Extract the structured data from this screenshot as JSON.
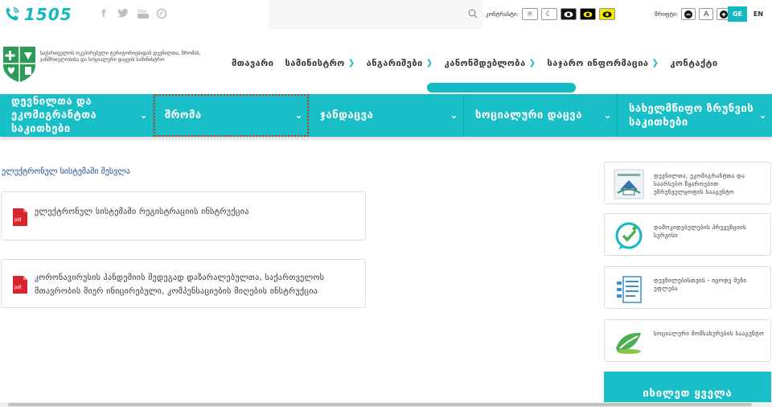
{
  "topbar": {
    "hotline": "1505",
    "social_icons": [
      "facebook-icon",
      "twitter-icon",
      "youtube-icon",
      "circle-logo-icon"
    ],
    "contrast_label": "კონტრასტი:",
    "font_label": "შრიფტი:",
    "font_buttons": [
      "−",
      "A",
      "+"
    ],
    "languages": [
      "GE",
      "EN"
    ]
  },
  "header": {
    "logo_text": "საქართველოს ოკუპირებული ტერიტორიებიდან დევნილთა, შრომის, ჯანმრთელობისა და სოციალური დაცვის სამინისტრო",
    "nav": [
      {
        "label": "მთავარი",
        "has_dropdown": false
      },
      {
        "label": "სამინისტრო",
        "has_dropdown": true
      },
      {
        "label": "ანგარიშები",
        "has_dropdown": true
      },
      {
        "label": "კანონმდებლობა",
        "has_dropdown": true
      },
      {
        "label": "საჯარო ინფორმაცია",
        "has_dropdown": true
      },
      {
        "label": "კონტაქტი",
        "has_dropdown": false
      }
    ]
  },
  "categories": [
    {
      "label": "დევნილთა და ეკომიგრანტთა საკითხები"
    },
    {
      "label": "შრომა"
    },
    {
      "label": "ჯანდაცვა"
    },
    {
      "label": "სოციალური დაცვა"
    },
    {
      "label": "სახელმწიფო ზრუნვის საკითხები"
    }
  ],
  "content": {
    "section_title": "ელექტრონულ სისტემაში შესვლა",
    "pdf_label": "pdf",
    "documents": [
      {
        "line1": "ელექტრონულ სისტემაში რეგისტრაციის ინსტრუქცია",
        "line2": ""
      },
      {
        "line1": "კორონავირუსის პანდემიის შედეგად დაზარალებულთა, საქართველოს",
        "line2": "მთავრობის მიერ ინიცირებული, კომპენსაციების მიღების ინსტრუქცია"
      }
    ]
  },
  "sidebar": {
    "links": [
      {
        "label": "დევნილთა, ეკომიგრანტთა და საარსებო წყაროებით უზრუნველყოფის სააგენტო"
      },
      {
        "label": "დამოკიდებულების პრევენციის სერვისი"
      },
      {
        "label": "დევნილებისთვის - იცოდე შენი უფლება"
      },
      {
        "label": "სოციალური მომსახურების სააგენტო"
      }
    ],
    "see_all": "იხილეთ ყველა"
  },
  "colors": {
    "accent": "#19bfc7",
    "link": "#1a4e8f",
    "pdf": "#d9232d"
  }
}
